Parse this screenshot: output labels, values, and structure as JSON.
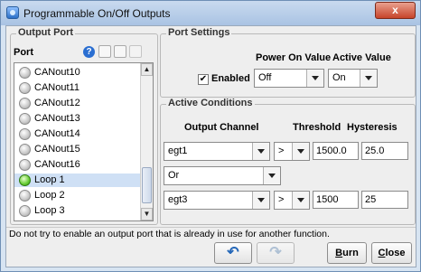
{
  "window": {
    "title": "Programmable On/Off Outputs",
    "close_glyph": "x"
  },
  "output_port": {
    "legend": "Output Port",
    "port_label": "Port",
    "help_glyph": "?",
    "items": [
      {
        "label": "CANout10",
        "active": false,
        "selected": false
      },
      {
        "label": "CANout11",
        "active": false,
        "selected": false
      },
      {
        "label": "CANout12",
        "active": false,
        "selected": false
      },
      {
        "label": "CANout13",
        "active": false,
        "selected": false
      },
      {
        "label": "CANout14",
        "active": false,
        "selected": false
      },
      {
        "label": "CANout15",
        "active": false,
        "selected": false
      },
      {
        "label": "CANout16",
        "active": false,
        "selected": false
      },
      {
        "label": "Loop 1",
        "active": true,
        "selected": true
      },
      {
        "label": "Loop 2",
        "active": false,
        "selected": false
      },
      {
        "label": "Loop 3",
        "active": false,
        "selected": false
      }
    ]
  },
  "port_settings": {
    "legend": "Port Settings",
    "power_on_header": "Power On Value",
    "active_value_header": "Active Value",
    "enabled_label": "Enabled",
    "enabled_check": "✔",
    "power_on_value": "Off",
    "active_value": "On"
  },
  "active_conditions": {
    "legend": "Active Conditions",
    "output_channel_header": "Output Channel",
    "threshold_header": "Threshold",
    "hysteresis_header": "Hysteresis",
    "row1": {
      "channel": "egt1",
      "operator": ">",
      "threshold": "1500.0",
      "hysteresis": "25.0"
    },
    "logic": "Or",
    "row2": {
      "channel": "egt3",
      "operator": ">",
      "threshold": "1500",
      "hysteresis": "25"
    }
  },
  "status_text": "Do not try to enable an output port that is already in use for another function.",
  "buttons": {
    "burn_first": "B",
    "burn_rest": "urn",
    "close_first": "C",
    "close_rest": "lose"
  }
}
